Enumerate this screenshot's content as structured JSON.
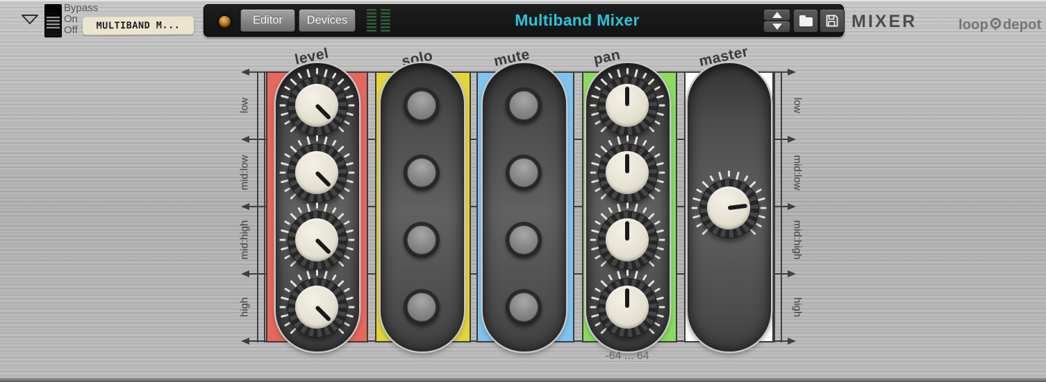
{
  "header": {
    "bypass_switch_labels": [
      "Bypass",
      "On",
      "Off"
    ],
    "preset_name": "MULTIBAND M...",
    "editor_button": "Editor",
    "devices_button": "Devices",
    "title": "Multiband Mixer",
    "title_color": "#2ac4da",
    "app_name": "MIXER",
    "brand": {
      "left": "loop",
      "right": "depot"
    },
    "meters": {
      "columns": 2,
      "segments": 7
    }
  },
  "mixer": {
    "bands": [
      "low",
      "mid:low",
      "mid:high",
      "high"
    ],
    "pan_range_label": "-64 ... 64",
    "columns": [
      {
        "label": "level",
        "color": "#e5685d",
        "control": "knob",
        "knob_angles": [
          135,
          135,
          135,
          135
        ]
      },
      {
        "label": "solo",
        "color": "#e3d53a",
        "control": "button"
      },
      {
        "label": "mute",
        "color": "#7fc4ef",
        "control": "button"
      },
      {
        "label": "pan",
        "color": "#8bdb5f",
        "control": "knob",
        "knob_angles": [
          0,
          0,
          0,
          0
        ]
      },
      {
        "label": "master",
        "color": "#ffffff",
        "control": "knob",
        "knob_angles": [
          83
        ]
      }
    ]
  }
}
